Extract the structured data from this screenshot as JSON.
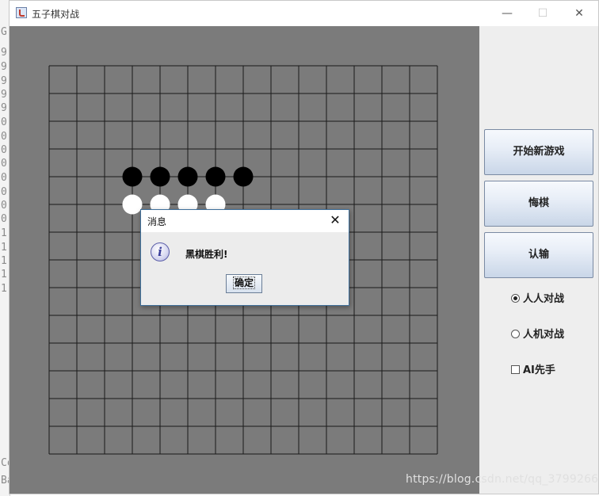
{
  "window": {
    "title": "五子棋对战",
    "controls": {
      "minimize": "—",
      "maximize": "☐",
      "close": "✕"
    }
  },
  "background_strip": {
    "chars": [
      "G",
      "9",
      "9",
      "9",
      "9",
      "9",
      "0",
      "0",
      "0",
      "0",
      "0",
      "0",
      "0",
      "0",
      "1",
      "1",
      "1",
      "1",
      "1",
      "Co",
      "Ba"
    ]
  },
  "board": {
    "size": 15,
    "stones": [
      {
        "color": "black",
        "col": 3,
        "row": 4
      },
      {
        "color": "black",
        "col": 4,
        "row": 4
      },
      {
        "color": "black",
        "col": 5,
        "row": 4
      },
      {
        "color": "black",
        "col": 6,
        "row": 4
      },
      {
        "color": "black",
        "col": 7,
        "row": 4
      },
      {
        "color": "white",
        "col": 3,
        "row": 5
      },
      {
        "color": "white",
        "col": 4,
        "row": 5
      },
      {
        "color": "white",
        "col": 5,
        "row": 5
      },
      {
        "color": "white",
        "col": 6,
        "row": 5
      }
    ]
  },
  "side_panel": {
    "new_game_label": "开始新游戏",
    "undo_label": "悔棋",
    "resign_label": "认输",
    "mode_pvp_label": "人人对战",
    "mode_pvp_selected": true,
    "mode_pve_label": "人机对战",
    "mode_pve_selected": false,
    "ai_first_label": "AI先手",
    "ai_first_checked": false
  },
  "dialog": {
    "title": "消息",
    "close": "✕",
    "icon": "info-icon",
    "message": "黑棋胜利!",
    "ok_label": "确定"
  },
  "watermark": "https://blog.csdn.net/qq_37992662",
  "colors": {
    "board_bg": "#7b7b7b",
    "grid_line": "#1a1a1a",
    "black_stone": "#000000",
    "white_stone": "#ffffff"
  }
}
